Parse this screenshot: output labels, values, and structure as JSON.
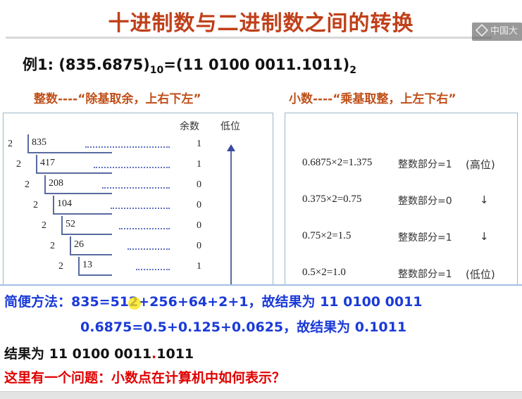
{
  "title": "十进制数与二进制数之间的转换",
  "logo_text": "中国大",
  "example": {
    "prefix": "例1: (835.6875)",
    "base_from": "10",
    "middle": "=(11 0100 0011.1011)",
    "base_to": "2"
  },
  "integer_method": "整数----“除基取余，上右下左”",
  "fraction_method": "小数----“乘基取整，上左下右”",
  "left_panel": {
    "header_remainder": "余数",
    "header_low": "低位",
    "rows": [
      {
        "divisor": "2",
        "dividend": "835",
        "remainder": "1"
      },
      {
        "divisor": "2",
        "dividend": "417",
        "remainder": "1"
      },
      {
        "divisor": "2",
        "dividend": "208",
        "remainder": "0"
      },
      {
        "divisor": "2",
        "dividend": "104",
        "remainder": "0"
      },
      {
        "divisor": "2",
        "dividend": "52",
        "remainder": "0"
      },
      {
        "divisor": "2",
        "dividend": "26",
        "remainder": "0"
      },
      {
        "divisor": "2",
        "dividend": "13",
        "remainder": "1"
      }
    ]
  },
  "right_panel": {
    "rows": [
      {
        "expr": "0.6875×2=1.375",
        "part": "整数部分=1",
        "note": "(高位)"
      },
      {
        "expr": "0.375×2=0.75",
        "part": "整数部分=0",
        "note": "↓"
      },
      {
        "expr": "0.75×2=1.5",
        "part": "整数部分=1",
        "note": "↓"
      },
      {
        "expr": "0.5×2=1.0",
        "part": "整数部分=1",
        "note": "(低位)"
      }
    ]
  },
  "bottom": {
    "line1": "简便方法：835=512+256+64+2+1，故结果为 11 0100 0011",
    "line2": "0.6875=0.5+0.125+0.0625，故结果为 0.1011",
    "line3_a": "结果为 11 0100 0011",
    "line3_dot": ".",
    "line3_b": "1011",
    "line4": "这里有一个问题：小数点在计算机中如何表示？"
  }
}
